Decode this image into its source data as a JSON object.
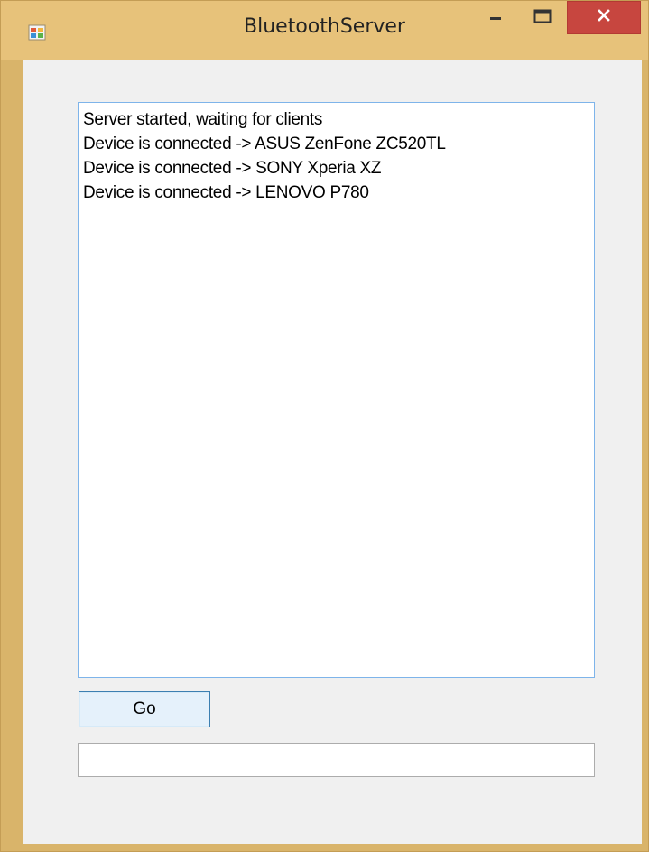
{
  "window": {
    "title": "BluetoothServer",
    "controls": [
      "minimize",
      "maximize",
      "close"
    ]
  },
  "log": {
    "lines": [
      "Server started, waiting for clients",
      "Device is connected -> ASUS ZenFone ZC520TL",
      "Device is connected -> SONY Xperia XZ",
      "Device is connected -> LENOVO P780"
    ]
  },
  "go_button": {
    "label": "Go"
  },
  "status_field": {
    "value": ""
  },
  "icons": {
    "app": "windows-form-icon",
    "minimize": "minimize-icon",
    "maximize": "maximize-icon",
    "close": "close-icon"
  },
  "colors": {
    "titlebar": "#e7c27a",
    "close_button": "#c7463f",
    "client_area": "#f0f0f0",
    "focus_border": "#7eb4ea"
  }
}
